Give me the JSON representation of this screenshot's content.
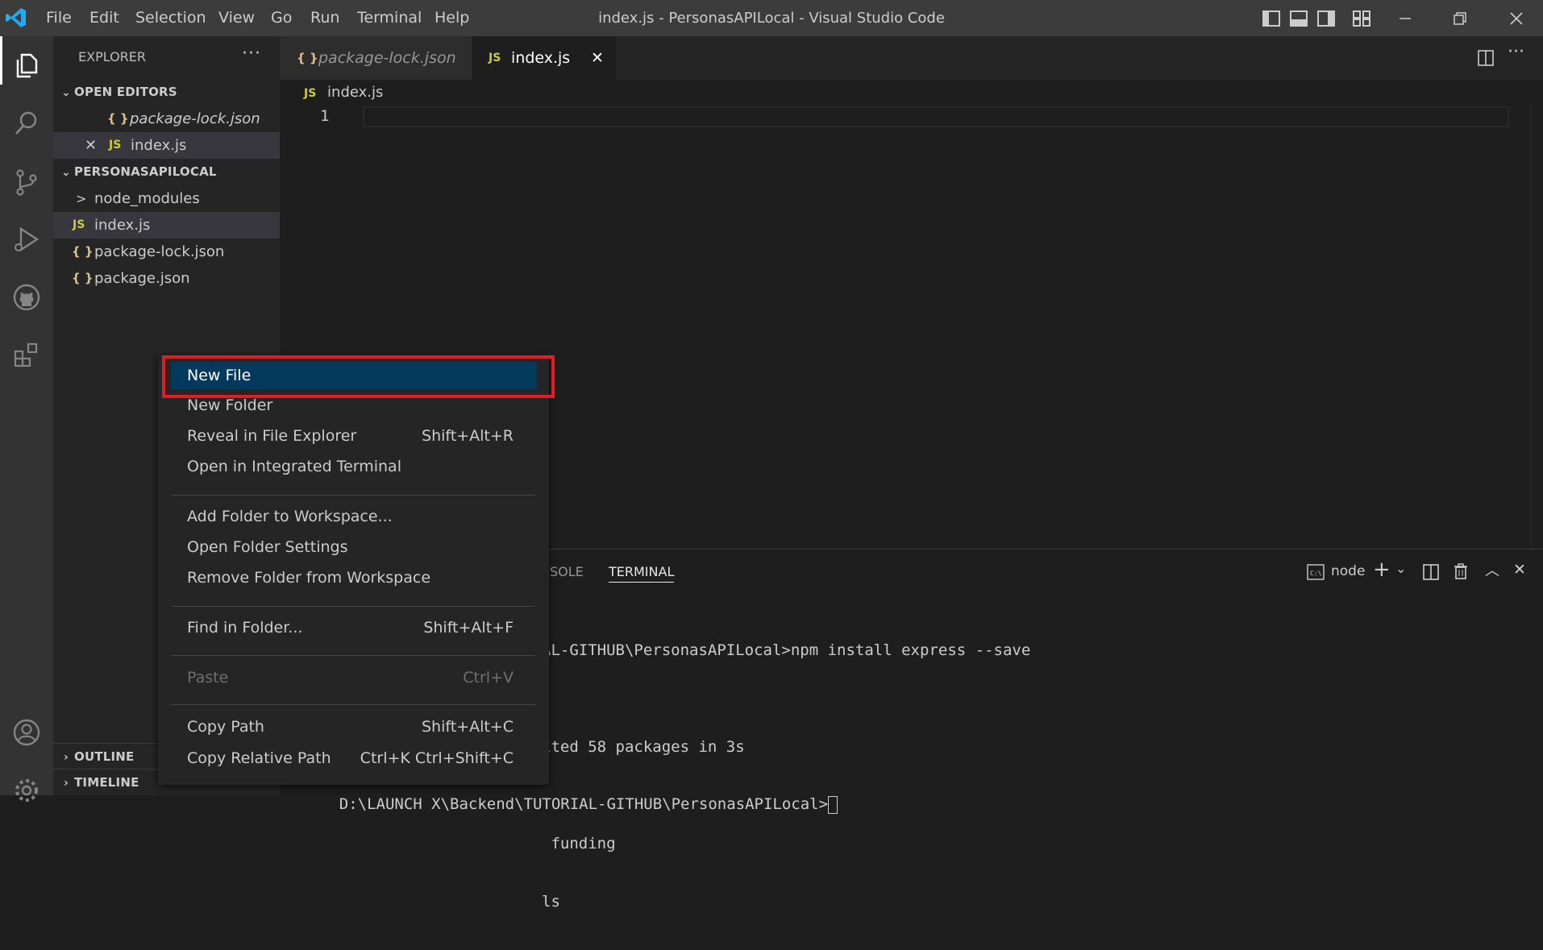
{
  "titlebar": {
    "menus": [
      "File",
      "Edit",
      "Selection",
      "View",
      "Go",
      "Run",
      "Terminal",
      "Help"
    ],
    "window_title": "index.js - PersonasAPILocal - Visual Studio Code"
  },
  "explorer": {
    "title": "EXPLORER",
    "open_editors_label": "OPEN EDITORS",
    "open_editors": [
      {
        "icon": "{ }",
        "name": "package-lock.json"
      },
      {
        "icon": "JS",
        "name": "index.js"
      }
    ],
    "folder_label": "PERSONASAPILOCAL",
    "files": [
      {
        "icon": ">",
        "name": "node_modules"
      },
      {
        "icon": "JS",
        "name": "index.js"
      },
      {
        "icon": "{ }",
        "name": "package-lock.json"
      },
      {
        "icon": "{ }",
        "name": "package.json"
      }
    ],
    "outline_label": "OUTLINE",
    "timeline_label": "TIMELINE"
  },
  "tabs": [
    {
      "icon": "{ }",
      "name": "package-lock.json"
    },
    {
      "icon": "JS",
      "name": "index.js"
    }
  ],
  "editor": {
    "breadcrumb_icon": "JS",
    "breadcrumb": "index.js",
    "line_number": "1"
  },
  "panel": {
    "tab_console": "SOLE",
    "tab_terminal": "TERMINAL",
    "terminal_name": "node",
    "terminal_lines": [
      "AL-GITHUB\\PersonasAPILocal>npm install express --save",
      "",
      "ited 58 packages in 3s",
      "",
      " funding",
      "ls",
      "",
      "",
      ""
    ],
    "prompt": "D:\\LAUNCH X\\Backend\\TUTORIAL-GITHUB\\PersonasAPILocal>"
  },
  "context_menu": {
    "items": [
      {
        "label": "New File",
        "shortcut": ""
      },
      {
        "label": "New Folder",
        "shortcut": ""
      },
      {
        "label": "Reveal in File Explorer",
        "shortcut": "Shift+Alt+R"
      },
      {
        "label": "Open in Integrated Terminal",
        "shortcut": ""
      },
      {
        "label": "Add Folder to Workspace...",
        "shortcut": ""
      },
      {
        "label": "Open Folder Settings",
        "shortcut": ""
      },
      {
        "label": "Remove Folder from Workspace",
        "shortcut": ""
      },
      {
        "label": "Find in Folder...",
        "shortcut": "Shift+Alt+F"
      },
      {
        "label": "Paste",
        "shortcut": "Ctrl+V"
      },
      {
        "label": "Copy Path",
        "shortcut": "Shift+Alt+C"
      },
      {
        "label": "Copy Relative Path",
        "shortcut": "Ctrl+K Ctrl+Shift+C"
      }
    ]
  },
  "colors": {
    "accent_blue": "#007acc",
    "menu_active": "#04395e",
    "highlight_red": "#e51b24",
    "json_icon": "#e2c08d",
    "js_icon": "#cbcb41"
  }
}
